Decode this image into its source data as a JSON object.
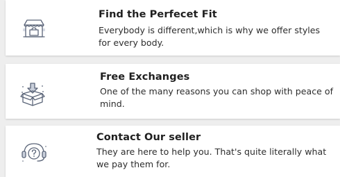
{
  "features": [
    {
      "icon": "storefront-icon",
      "title": "Find the Perfecet Fit",
      "description": "Everybody is different,which is why we offer styles for every body."
    },
    {
      "icon": "box-download-icon",
      "title": "Free Exchanges",
      "description": "One of the many reasons you can shop with peace of mind."
    },
    {
      "icon": "support-chat-icon",
      "title": "Contact Our seller",
      "description": "They are here to help you. That's quite literally what we pay them for."
    }
  ],
  "colors": {
    "background": "#eeeeee",
    "card": "#ffffff",
    "title": "#1f1f1f",
    "text": "#2d2d2d",
    "icon_stroke": "#5a6478",
    "icon_accent": "#c9cfdb"
  }
}
